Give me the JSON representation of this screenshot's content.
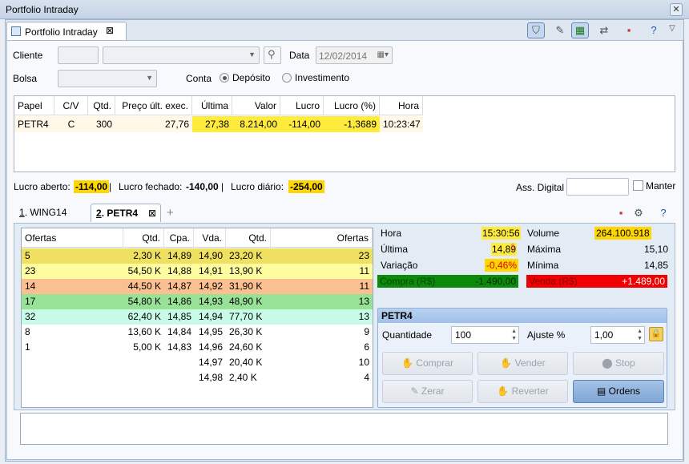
{
  "window": {
    "title": "Portfolio Intraday"
  },
  "doc_tab": {
    "label": "Portfolio Intraday"
  },
  "form": {
    "cliente_label": "Cliente",
    "data_label": "Data",
    "data_value": "12/02/2014",
    "bolsa_label": "Bolsa",
    "conta_label": "Conta",
    "radio_deposito": "Depósito",
    "radio_investimento": "Investimento",
    "conta_selected": "Depósito"
  },
  "positions": {
    "headers": [
      "Papel",
      "C/V",
      "Qtd.",
      "Preço últ. exec.",
      "Última",
      "Valor",
      "Lucro",
      "Lucro (%)",
      "Hora"
    ],
    "rows": [
      {
        "papel": "PETR4",
        "cv": "C",
        "qtd": "300",
        "preco": "27,76",
        "ultima": "27,38",
        "valor": "8.214,00",
        "lucro": "-114,00",
        "lucro_pct": "-1,3689",
        "hora": "10:23:47"
      }
    ]
  },
  "summary": {
    "aberto_label": "Lucro aberto:",
    "aberto_value": "-114,00",
    "fechado_label": "Lucro fechado:",
    "fechado_value": "-140,00",
    "diario_label": "Lucro diário:",
    "diario_value": "-254,00",
    "sep": "|",
    "assinatura_label": "Ass. Digital",
    "manter_label": "Manter"
  },
  "subtabs": [
    {
      "num": "1",
      "label": ". WING14"
    },
    {
      "num": "2",
      "label": ". PETR4"
    }
  ],
  "book": {
    "headers": [
      "Ofertas",
      "Qtd.",
      "Cpa.",
      "Vda.",
      "Qtd.",
      "Ofertas"
    ],
    "rows": [
      {
        "of1": "5",
        "q1": "2,30 K",
        "cpa": "14,89",
        "vda": "14,90",
        "q2": "23,20 K",
        "of2": "23",
        "color": "#efe062"
      },
      {
        "of1": "23",
        "q1": "54,50 K",
        "cpa": "14,88",
        "vda": "14,91",
        "q2": "13,90 K",
        "of2": "11",
        "color": "#fdfda0"
      },
      {
        "of1": "14",
        "q1": "44,50 K",
        "cpa": "14,87",
        "vda": "14,92",
        "q2": "31,90 K",
        "of2": "11",
        "color": "#fbc08f"
      },
      {
        "of1": "17",
        "q1": "54,80 K",
        "cpa": "14,86",
        "vda": "14,93",
        "q2": "48,90 K",
        "of2": "13",
        "color": "#98e297"
      },
      {
        "of1": "32",
        "q1": "62,40 K",
        "cpa": "14,85",
        "vda": "14,94",
        "q2": "77,70 K",
        "of2": "13",
        "color": "#c8fbe7"
      },
      {
        "of1": "8",
        "q1": "13,60 K",
        "cpa": "14,84",
        "vda": "14,95",
        "q2": "26,30 K",
        "of2": "9",
        "color": ""
      },
      {
        "of1": "1",
        "q1": "5,00 K",
        "cpa": "14,83",
        "vda": "14,96",
        "q2": "24,60 K",
        "of2": "6",
        "color": ""
      },
      {
        "of1": "",
        "q1": "",
        "cpa": "",
        "vda": "14,97",
        "q2": "20,40 K",
        "of2": "10",
        "color": ""
      },
      {
        "of1": "",
        "q1": "",
        "cpa": "",
        "vda": "14,98",
        "q2": "2,40 K",
        "of2": "4",
        "color": ""
      }
    ]
  },
  "quote": {
    "hora_label": "Hora",
    "hora_value": "15:30:56",
    "ultima_label": "Última",
    "ultima_value": "14,89",
    "variacao_label": "Variação",
    "variacao_value": "-0,46%",
    "compra_label": "Compra (R$)",
    "compra_value": "-1.490,00",
    "volume_label": "Volume",
    "volume_value": "264.100.918",
    "maxima_label": "Máxima",
    "maxima_value": "15,10",
    "minima_label": "Mínima",
    "minima_value": "14,85",
    "venda_label": "Venda (R$)",
    "venda_value": "+1.489,00",
    "compra_color": "#0c8a0c",
    "venda_color": "#f00000"
  },
  "order": {
    "title": "PETR4",
    "quantidade_label": "Quantidade",
    "quantidade_value": "100",
    "ajuste_label": "Ajuste %",
    "ajuste_value": "1,00",
    "buttons": {
      "comprar": "Comprar",
      "vender": "Vender",
      "stop": "Stop",
      "zerar": "Zerar",
      "reverter": "Reverter",
      "ordens": "Ordens"
    }
  }
}
